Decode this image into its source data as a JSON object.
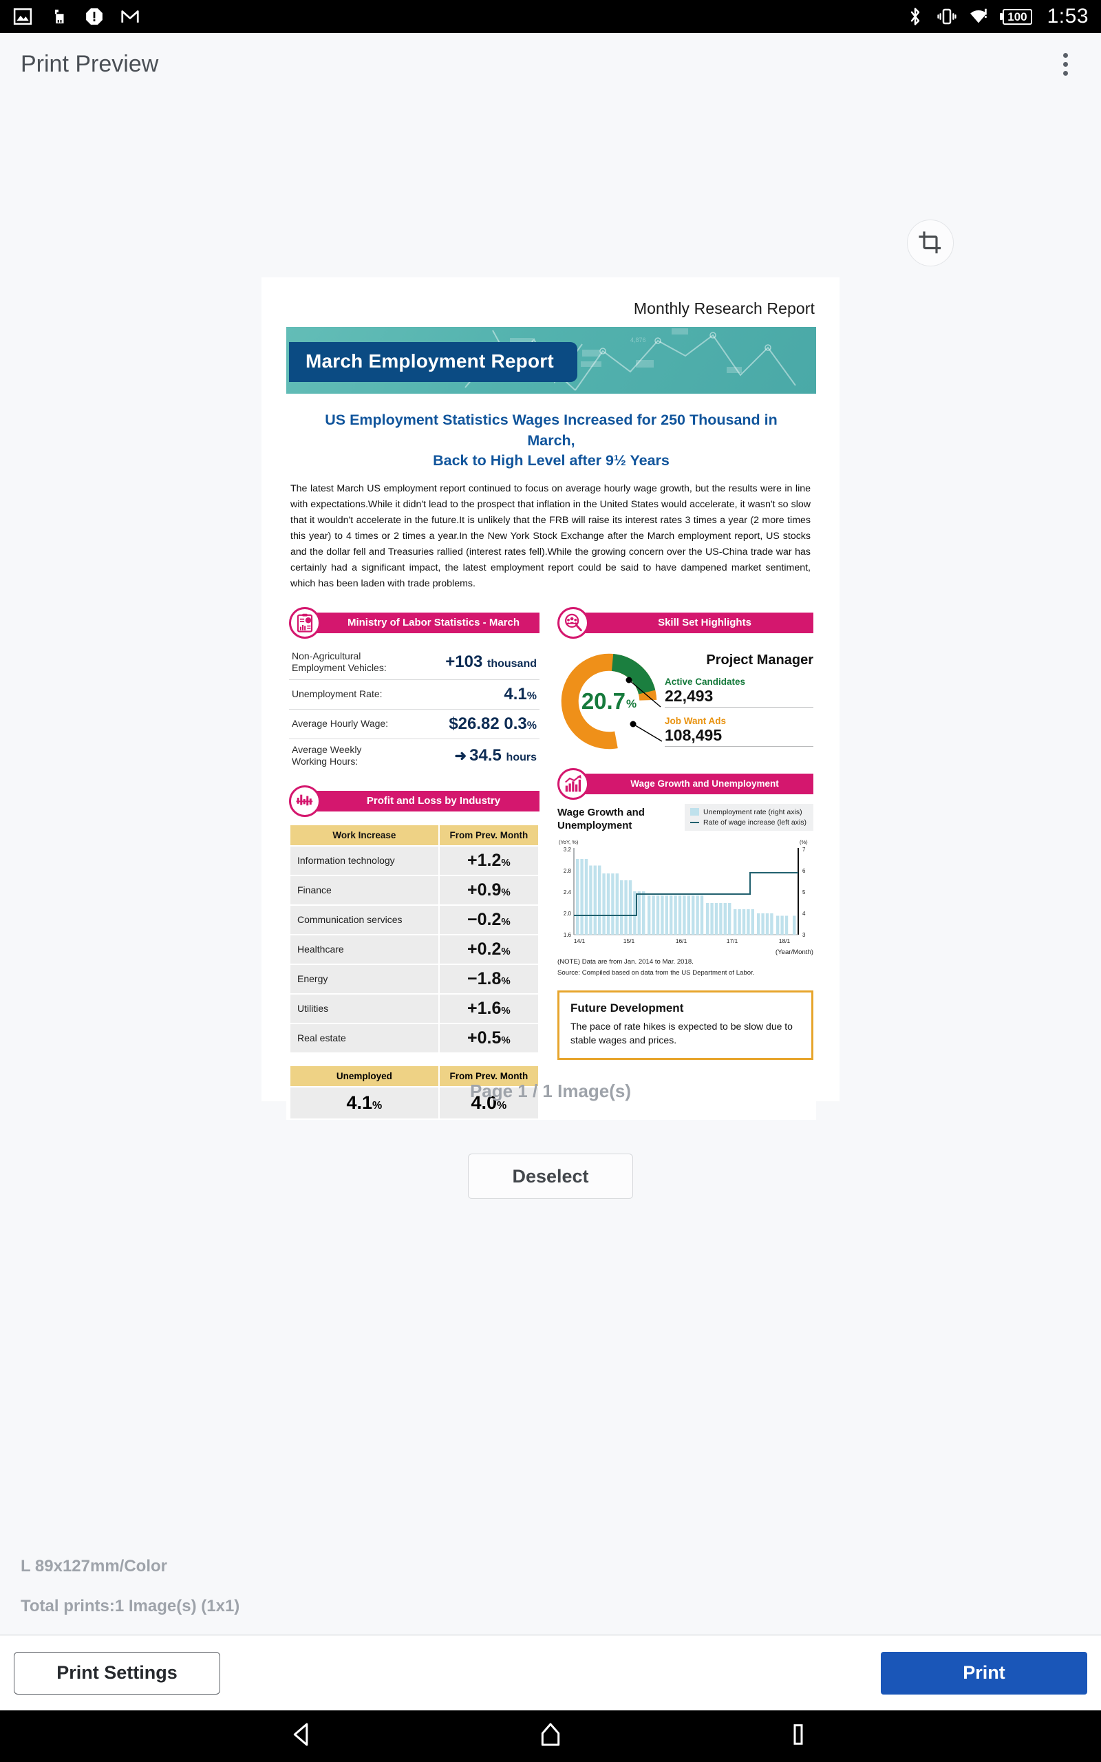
{
  "status_bar": {
    "icons_left": [
      "image-icon",
      "usb-device-icon",
      "alert-octagon-icon",
      "gmail-icon"
    ],
    "icons_right": [
      "bluetooth-icon",
      "vibrate-icon",
      "wifi-alert-icon"
    ],
    "battery": "100",
    "time": "1:53"
  },
  "app_bar": {
    "title": "Print Preview",
    "menu_icon": "kebab-menu-icon"
  },
  "preview": {
    "crop_icon": "crop-icon",
    "page_count": "Page 1 / 1 Image(s)",
    "deselect_label": "Deselect"
  },
  "footer": {
    "paper": "L 89x127mm/Color",
    "total": "Total prints:1 Image(s) (1x1)",
    "print_settings_label": "Print Settings",
    "print_label": "Print"
  },
  "nav_bar": {
    "back": "back-triangle-icon",
    "home": "home-icon",
    "recents": "recents-square-icon"
  },
  "document": {
    "kicker": "Monthly Research Report",
    "banner_title": "March Employment Report",
    "headline_line1": "US Employment Statistics   Wages Increased for 250 Thousand in March,",
    "headline_line2": "Back to High Level after 9½ Years",
    "paragraph": "The latest March US employment report continued to focus on average hourly wage growth, but the results were in line with expectations.While it didn't lead to the prospect that inflation in the United States would accelerate, it wasn't so slow that it wouldn't accelerate in the future.It is unlikely that the FRB will raise its interest rates 3 times a year (2 more times this year) to 4 times or 2 times a year.In the New York Stock Exchange after the March employment report, US stocks and the dollar fell and Treasuries rallied (interest rates fell).While the growing concern over the US-China trade war has certainly had a significant impact, the latest employment report could be said to have dampened market sentiment, which has been laden with trade problems.",
    "ministry": {
      "icon": "clipboard-chart-icon",
      "title": "Ministry of Labor Statistics - March",
      "rows": [
        {
          "label": "Non-Agricultural\nEmployment Vehicles:",
          "value": "+103",
          "unit": "thousand"
        },
        {
          "label": "Unemployment Rate:",
          "value": "4.1",
          "unit": "%"
        },
        {
          "label": "Average Hourly Wage:",
          "value": "$26.82 0.3",
          "unit": "%"
        },
        {
          "label": "Average Weekly\nWorking Hours:",
          "value": "34.5",
          "unit": "hours",
          "arrow": "➜"
        }
      ]
    },
    "skills": {
      "icon": "people-search-icon",
      "title": "Skill Set Highlights",
      "role": "Project Manager",
      "donut_value": "20.7",
      "donut_unit": "%",
      "active_candidates_label": "Active Candidates",
      "active_candidates_value": "22,493",
      "job_want_ads_label": "Job Want Ads",
      "job_want_ads_value": "108,495",
      "green": "#1b7f3f",
      "orange": "#ef9019"
    },
    "industry": {
      "icon": "bar-chart-icon",
      "title": "Profit and Loss by Industry",
      "col1": "Work Increase",
      "col2": "From Prev. Month",
      "rows": [
        {
          "name": "Information technology",
          "value": "+1.2",
          "pct": "%"
        },
        {
          "name": "Finance",
          "value": "+0.9",
          "pct": "%"
        },
        {
          "name": "Communication services",
          "value": "−0.2",
          "pct": "%"
        },
        {
          "name": "Healthcare",
          "value": "+0.2",
          "pct": "%"
        },
        {
          "name": "Energy",
          "value": "−1.8",
          "pct": "%"
        },
        {
          "name": "Utilities",
          "value": "+1.6",
          "pct": "%"
        },
        {
          "name": "Real estate",
          "value": "+0.5",
          "pct": "%"
        }
      ],
      "unemployed_col1": "Unemployed",
      "unemployed_col2": "From Prev. Month",
      "unemployed_v1": "4.1",
      "unemployed_v1_pct": "%",
      "unemployed_v2": "4.0",
      "unemployed_v2_pct": "%"
    },
    "wage": {
      "icon": "growth-chart-icon",
      "title": "Wage Growth and Unemployment",
      "note1": "(NOTE) Data are from Jan. 2014 to Mar. 2018.",
      "note2": "Source: Compiled based on data from the US Department of Labor."
    },
    "future": {
      "title": "Future Development",
      "body": "The pace of rate hikes is expected to be slow due to stable wages and prices."
    }
  },
  "chart_data": {
    "type": "bar",
    "title": "Wage Growth and Unemployment",
    "xlabel": "(Year/Month)",
    "ylabel": "(YoY, %)",
    "y2label": "(%)",
    "ylim": [
      1.6,
      3.2
    ],
    "y2lim": [
      3,
      7
    ],
    "yticks": [
      "1.6",
      "2.0",
      "2.4",
      "2.8",
      "3.2"
    ],
    "y2ticks": [
      "3",
      "4",
      "5",
      "6",
      "7"
    ],
    "xticks": [
      "14/1",
      "15/1",
      "16/1",
      "17/1",
      "18/1"
    ],
    "grid": false,
    "legend_position": "top-right",
    "series": [
      {
        "name": "Unemployment rate (right axis)",
        "type": "bar",
        "color": "#bfe1ec",
        "axis": "right",
        "values": [
          6.5,
          6.5,
          6.5,
          6.2,
          6.2,
          6.2,
          5.8,
          5.8,
          5.8,
          5.8,
          5.5,
          5.5,
          5.5,
          5.0,
          5.0,
          5.0,
          4.8,
          4.8,
          4.8,
          4.8,
          4.8,
          4.8,
          4.8,
          4.8,
          4.8,
          4.6,
          4.6,
          4.6,
          4.6,
          4.6,
          4.3,
          4.3,
          4.3,
          4.3,
          4.3,
          4.2,
          4.2,
          4.2,
          4.2,
          4.2,
          4.1,
          4.1,
          4.1,
          4.1,
          4.1,
          4.1,
          4.1,
          4.1,
          4.1,
          4.1,
          4.1
        ]
      },
      {
        "name": "Rate of wage increase (left axis)",
        "type": "step-line",
        "color": "#21606e",
        "axis": "left",
        "values": [
          2.0,
          2.0,
          2.0,
          2.0,
          2.0,
          2.0,
          2.0,
          2.0,
          2.0,
          2.0,
          2.0,
          2.0,
          2.0,
          2.0,
          2.4,
          2.4,
          2.4,
          2.4,
          2.4,
          2.4,
          2.4,
          2.4,
          2.4,
          2.4,
          2.4,
          2.4,
          2.4,
          2.4,
          2.4,
          2.4,
          2.4,
          2.4,
          2.4,
          2.4,
          2.4,
          2.4,
          2.4,
          2.4,
          2.8,
          2.8,
          2.8,
          2.8,
          2.8,
          2.8,
          2.8,
          2.8,
          2.8,
          2.8,
          2.8,
          2.8,
          2.8
        ]
      }
    ]
  },
  "donut_chart": {
    "type": "pie",
    "title": "Project Manager",
    "labels": [
      "Active Candidates",
      "Job Want Ads"
    ],
    "values": [
      20.7,
      79.3
    ],
    "colors": [
      "#1b7f3f",
      "#ef9019"
    ],
    "center_label": "20.7%"
  }
}
